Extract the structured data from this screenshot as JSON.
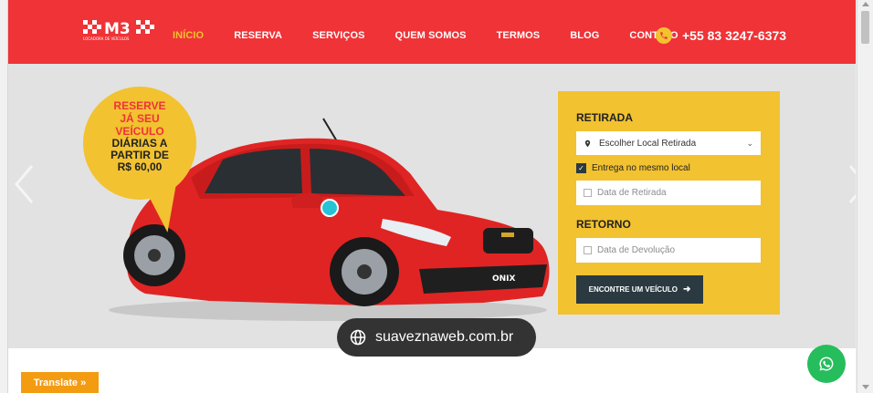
{
  "header": {
    "logo_text": "M3",
    "logo_tagline": "LOCADORA DE VEÍCULOS",
    "nav": [
      {
        "label": "INÍCIO",
        "active": true
      },
      {
        "label": "RESERVA"
      },
      {
        "label": "SERVIÇOS"
      },
      {
        "label": "QUEM SOMOS"
      },
      {
        "label": "TERMOS"
      },
      {
        "label": "BLOG"
      },
      {
        "label": "CONTATO"
      }
    ],
    "phone": "+55 83 3247-6373",
    "phone_icon": "phone-icon"
  },
  "hero": {
    "bubble_line1": "RESERVE",
    "bubble_line2": "JÁ SEU",
    "bubble_line3": "VEÍCULO",
    "bubble_line4": "DIÁRIAS A",
    "bubble_line5": "PARTIR DE",
    "bubble_line6": "R$ 60,00",
    "car_badge": "ONIX"
  },
  "reservation": {
    "pickup_heading": "RETIRADA",
    "pickup_location": "Escolher Local Retirada",
    "same_location_label": "Entrega no mesmo local",
    "same_location_checked": true,
    "pickup_date_placeholder": "Data de Retirada",
    "return_heading": "RETORNO",
    "return_date_placeholder": "Data de Devolução",
    "find_button": "ENCONTRE UM VEÍCULO"
  },
  "watermark": "suaveznaweb.com.br",
  "translate_label": "Translate »",
  "colors": {
    "brand_red": "#ef3337",
    "accent_yellow": "#f2c230",
    "dark_button": "#2b3a40",
    "whatsapp_green": "#26bd5c",
    "translate_orange": "#f39c12"
  }
}
